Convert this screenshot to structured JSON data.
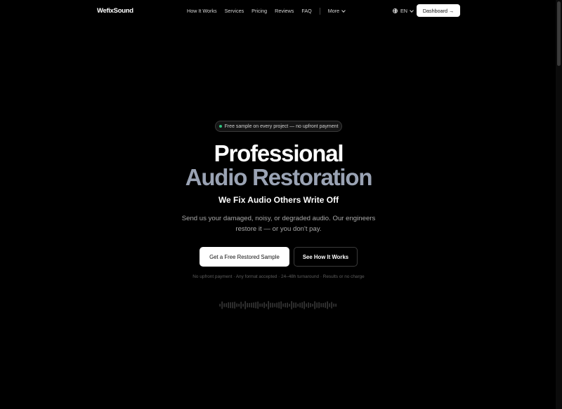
{
  "nav": {
    "logo": "WefixSound",
    "links": [
      "How It Works",
      "Services",
      "Pricing",
      "Reviews",
      "FAQ"
    ],
    "more_label": "More",
    "language": "EN",
    "dashboard_label": "Dashboard →"
  },
  "hero": {
    "badge": "Free sample on every project — no upfront payment",
    "title_line1": "Professional",
    "title_line2": "Audio Restoration",
    "subtitle": "We Fix Audio Others Write Off",
    "description": "Send us your damaged, noisy, or degraded audio. Our engineers restore it — or you don't pay.",
    "primary_cta": "Get a Free Restored Sample",
    "secondary_cta": "See How It Works",
    "trust_line": "No upfront payment · Any format accepted · 24–48h turnaround · Results or no charge"
  },
  "colors": {
    "background": "#000000",
    "accent_secondary_title": "#9aa3b4",
    "badge_dot": "#2ec27e"
  }
}
